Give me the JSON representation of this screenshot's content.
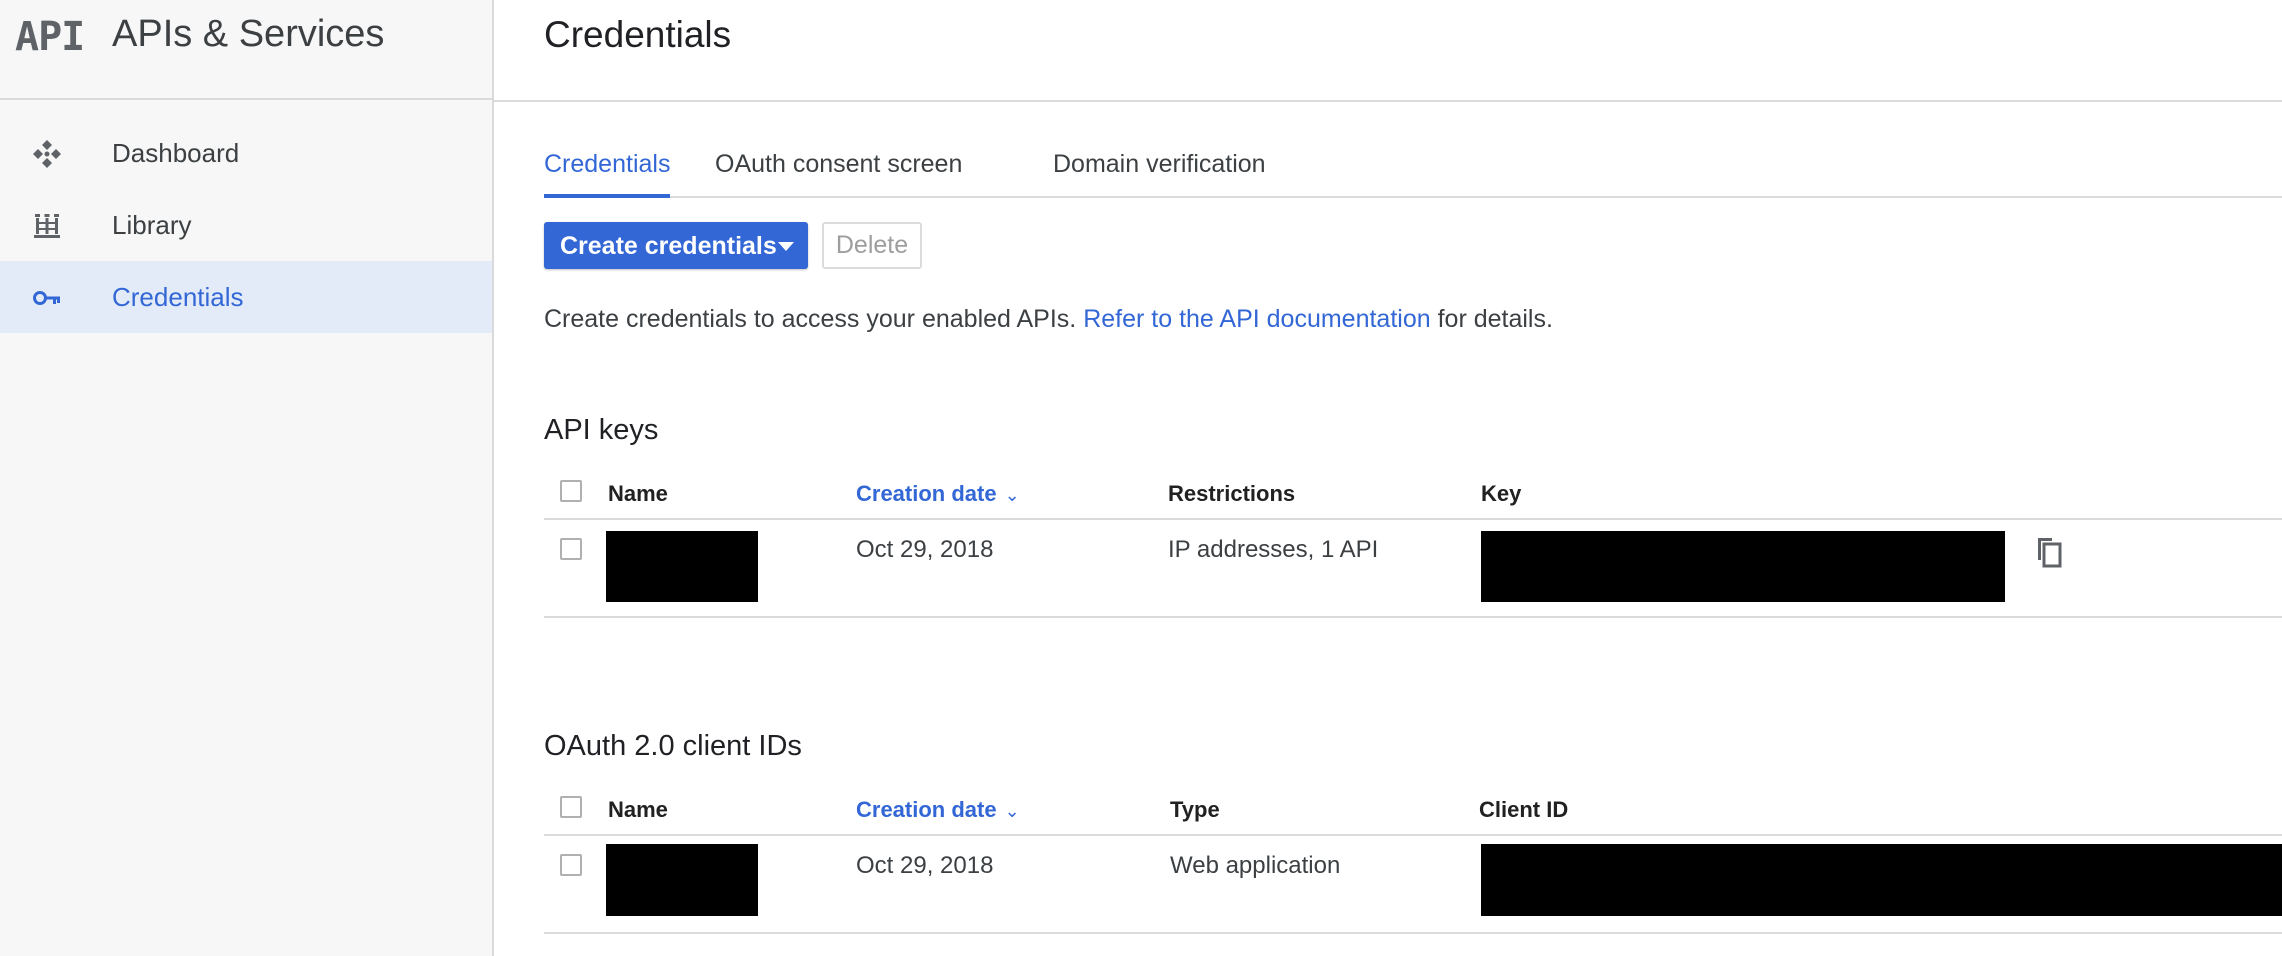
{
  "sidebar": {
    "logo_text": "API",
    "title": "APIs & Services",
    "items": [
      {
        "label": "Dashboard",
        "icon": "dashboard-icon"
      },
      {
        "label": "Library",
        "icon": "library-icon"
      },
      {
        "label": "Credentials",
        "icon": "key-icon",
        "active": true
      }
    ]
  },
  "header": {
    "title": "Credentials"
  },
  "tabs": [
    {
      "label": "Credentials",
      "active": true
    },
    {
      "label": "OAuth consent screen"
    },
    {
      "label": "Domain verification"
    }
  ],
  "toolbar": {
    "create_label": "Create credentials",
    "delete_label": "Delete"
  },
  "intro": {
    "prefix": "Create credentials to access your enabled APIs.",
    "link": "Refer to the API documentation",
    "suffix": "for details."
  },
  "api_keys": {
    "title": "API keys",
    "columns": [
      "Name",
      "Creation date",
      "Restrictions",
      "Key"
    ],
    "rows": [
      {
        "name": "",
        "creation_date": "Oct 29, 2018",
        "restrictions": "IP addresses, 1 API",
        "key": ""
      }
    ]
  },
  "oauth_clients": {
    "title": "OAuth 2.0 client IDs",
    "columns": [
      "Name",
      "Creation date",
      "Type",
      "Client ID"
    ],
    "rows": [
      {
        "name": "",
        "creation_date": "Oct 29, 2018",
        "type": "Web application",
        "client_id": ""
      }
    ]
  },
  "colors": {
    "accent": "#3367d6",
    "sidebar_bg": "#f7f7f7",
    "active_bg": "#e3ebf9",
    "redaction": "#000000"
  }
}
